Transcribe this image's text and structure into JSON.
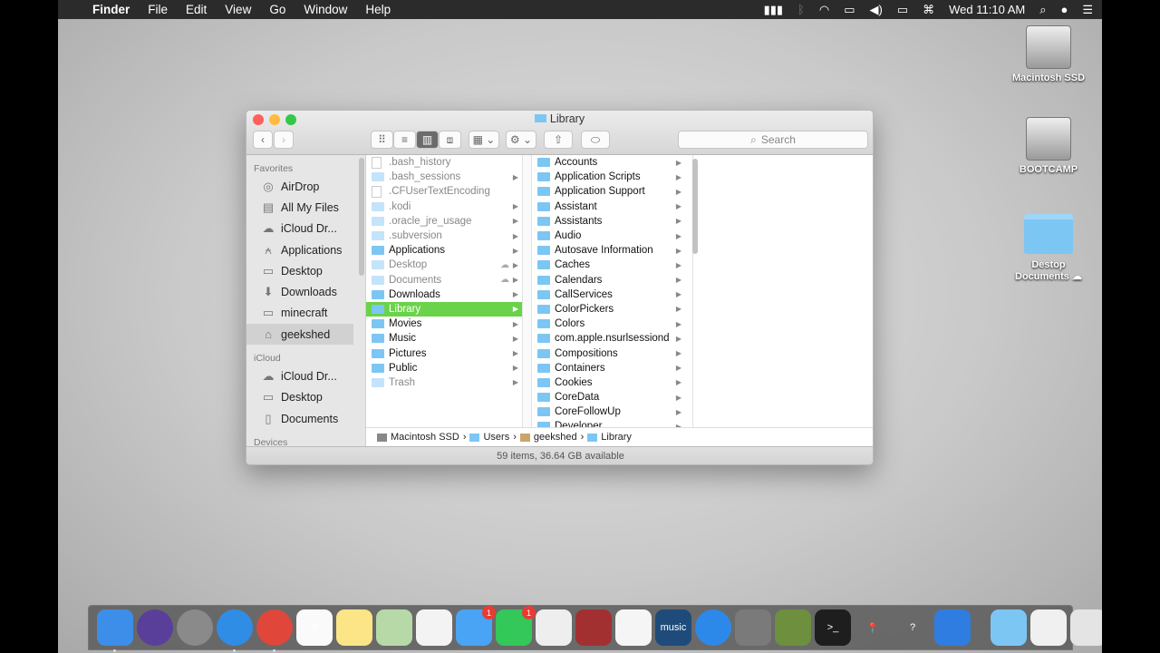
{
  "menubar": {
    "app": "Finder",
    "menus": [
      "File",
      "Edit",
      "View",
      "Go",
      "Window",
      "Help"
    ],
    "clock": "Wed 11:10 AM"
  },
  "desktop": [
    {
      "label": "Macintosh SSD",
      "icon": "hard-drive-icon"
    },
    {
      "label": "BOOTCAMP",
      "icon": "hard-drive-icon"
    },
    {
      "label": "Destop Documents",
      "icon": "folder-icon"
    }
  ],
  "window": {
    "title": "Library",
    "search_placeholder": "Search",
    "status": "59 items, 36.64 GB available",
    "sidebar": [
      {
        "header": "Favorites",
        "items": [
          {
            "label": "AirDrop",
            "icon": "◎"
          },
          {
            "label": "All My Files",
            "icon": "▤"
          },
          {
            "label": "iCloud Dr...",
            "icon": "☁"
          },
          {
            "label": "Applications",
            "icon": "⍲"
          },
          {
            "label": "Desktop",
            "icon": "▭"
          },
          {
            "label": "Downloads",
            "icon": "⬇"
          },
          {
            "label": "minecraft",
            "icon": "▭"
          },
          {
            "label": "geekshed",
            "icon": "⌂",
            "selected": true
          }
        ]
      },
      {
        "header": "iCloud",
        "items": [
          {
            "label": "iCloud Dr...",
            "icon": "☁"
          },
          {
            "label": "Desktop",
            "icon": "▭"
          },
          {
            "label": "Documents",
            "icon": "▯"
          }
        ]
      },
      {
        "header": "Devices",
        "items": []
      }
    ],
    "column1": [
      {
        "name": ".bash_history",
        "type": "file",
        "dim": true
      },
      {
        "name": ".bash_sessions",
        "dim": true,
        "arrow": true
      },
      {
        "name": ".CFUserTextEncoding",
        "type": "file",
        "dim": true
      },
      {
        "name": ".kodi",
        "dim": true,
        "arrow": true
      },
      {
        "name": ".oracle_jre_usage",
        "dim": true,
        "arrow": true
      },
      {
        "name": ".subversion",
        "dim": true,
        "arrow": true
      },
      {
        "name": "Applications",
        "arrow": true
      },
      {
        "name": "Desktop",
        "dim": true,
        "arrow": true,
        "cloud": true
      },
      {
        "name": "Documents",
        "dim": true,
        "arrow": true,
        "cloud": true
      },
      {
        "name": "Downloads",
        "arrow": true
      },
      {
        "name": "Library",
        "arrow": true,
        "selected": true
      },
      {
        "name": "Movies",
        "arrow": true
      },
      {
        "name": "Music",
        "arrow": true
      },
      {
        "name": "Pictures",
        "arrow": true
      },
      {
        "name": "Public",
        "arrow": true
      },
      {
        "name": "Trash",
        "dim": true,
        "arrow": true
      }
    ],
    "column2": [
      "Accounts",
      "Application Scripts",
      "Application Support",
      "Assistant",
      "Assistants",
      "Audio",
      "Autosave Information",
      "Caches",
      "Calendars",
      "CallServices",
      "ColorPickers",
      "Colors",
      "com.apple.nsurlsessiond",
      "Compositions",
      "Containers",
      "Cookies",
      "CoreData",
      "CoreFollowUp",
      "Developer"
    ],
    "path": [
      "Macintosh SSD",
      "Users",
      "geekshed",
      "Library"
    ],
    "accent": "#6ad34a"
  },
  "dock": [
    {
      "name": "finder",
      "bg": "#3d8ee8",
      "dot": true
    },
    {
      "name": "siri",
      "bg": "#5a3f9a"
    },
    {
      "name": "launchpad",
      "bg": "#8a8a8a"
    },
    {
      "name": "safari",
      "bg": "#2f8de6",
      "dot": true
    },
    {
      "name": "chrome",
      "bg": "#e0463a",
      "dot": true
    },
    {
      "name": "calendar",
      "bg": "#fafafa",
      "text": "9"
    },
    {
      "name": "notes",
      "bg": "#fbe586"
    },
    {
      "name": "maps",
      "bg": "#b7d9a8"
    },
    {
      "name": "photos",
      "bg": "#f3f3f3"
    },
    {
      "name": "messages",
      "bg": "#4aa4f5",
      "badge": "1"
    },
    {
      "name": "facetime",
      "bg": "#34c759",
      "badge": "1"
    },
    {
      "name": "textedit",
      "bg": "#eeeeee"
    },
    {
      "name": "photo-booth",
      "bg": "#a33030"
    },
    {
      "name": "itunes",
      "bg": "#f5f5f5"
    },
    {
      "name": "amazon-music",
      "bg": "#1e4b7a",
      "text": "music"
    },
    {
      "name": "app-store",
      "bg": "#2c89ea"
    },
    {
      "name": "system-preferences",
      "bg": "#7a7a7a"
    },
    {
      "name": "minecraft",
      "bg": "#6d8f3e"
    },
    {
      "name": "terminal",
      "bg": "#1e1e1e",
      "text": ">_"
    },
    {
      "name": "find-my",
      "bg": "transparent",
      "text": "📍"
    },
    {
      "name": "help",
      "bg": "transparent",
      "text": "?"
    },
    {
      "name": "xcode",
      "bg": "#2f7de0"
    },
    {
      "sep": true
    },
    {
      "name": "documents-stack",
      "bg": "#7cc6f4"
    },
    {
      "name": "chrome-window",
      "bg": "#f0f0f0"
    },
    {
      "name": "trash",
      "bg": "#e4e4e4"
    }
  ]
}
